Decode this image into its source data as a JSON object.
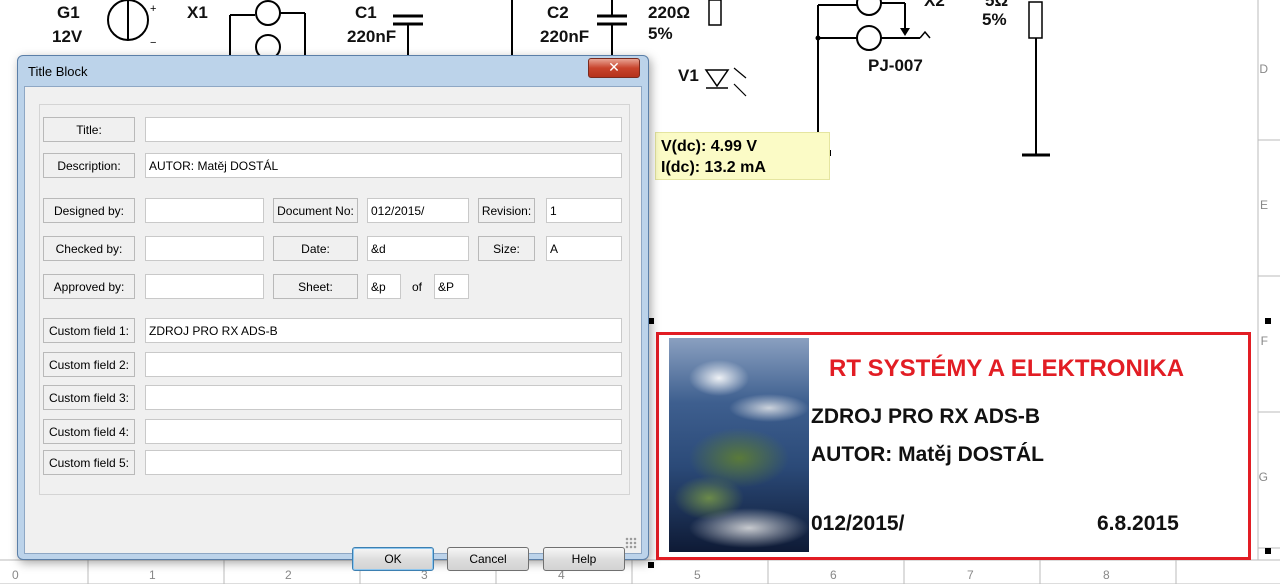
{
  "schematic": {
    "labels": {
      "g1": "G1",
      "g1_value": "12V",
      "x1": "X1",
      "x1_part": "PJ-007",
      "c1": "C1",
      "c1_value": "220nF",
      "c2": "C2",
      "c2_value": "220nF",
      "r_value": "220Ω",
      "r_tol": "5%",
      "v1": "V1",
      "x2_part": "PJ-007",
      "x2": "X2",
      "r2_value": "5Ω",
      "r2_tol": "5%"
    },
    "zones": [
      "D",
      "E",
      "F",
      "G"
    ],
    "ruler": [
      "0",
      "1",
      "2",
      "3",
      "4",
      "5",
      "6",
      "7",
      "8"
    ]
  },
  "probe": {
    "voltage": "V(dc): 4.99 V",
    "current": "I(dc): 13.2 mA"
  },
  "sheet_title_block": {
    "company": "RT SYSTÉMY A ELEKTRONIKA",
    "title": "ZDROJ PRO RX ADS-B",
    "author": "AUTOR: Matěj DOSTÁL",
    "doc_no": "012/2015/",
    "date": "6.8.2015"
  },
  "dialog": {
    "title": "Title Block",
    "close_glyph": "✕",
    "fields": {
      "title_label": "Title:",
      "title_value": "",
      "description_label": "Description:",
      "description_value": "AUTOR: Matěj DOSTÁL",
      "designed_by_label": "Designed by:",
      "designed_by_value": "",
      "document_no_label": "Document No:",
      "document_no_value": "012/2015/",
      "revision_label": "Revision:",
      "revision_value": "1",
      "checked_by_label": "Checked by:",
      "checked_by_value": "",
      "date_label": "Date:",
      "date_value": "&d",
      "size_label": "Size:",
      "size_value": "A",
      "approved_by_label": "Approved by:",
      "approved_by_value": "",
      "sheet_label": "Sheet:",
      "sheet_value": "&p",
      "of_label": "of",
      "of_value": "&P",
      "custom1_label": "Custom field 1:",
      "custom1_value": "ZDROJ PRO RX ADS-B",
      "custom2_label": "Custom field 2:",
      "custom2_value": "",
      "custom3_label": "Custom field 3:",
      "custom3_value": "",
      "custom4_label": "Custom field 4:",
      "custom4_value": "",
      "custom5_label": "Custom field 5:",
      "custom5_value": ""
    },
    "buttons": {
      "ok": "OK",
      "cancel": "Cancel",
      "help": "Help"
    }
  },
  "colors": {
    "title_block_border": "#e21d24",
    "company_text": "#e21d24",
    "probe_bg": "#fbfbc6"
  }
}
